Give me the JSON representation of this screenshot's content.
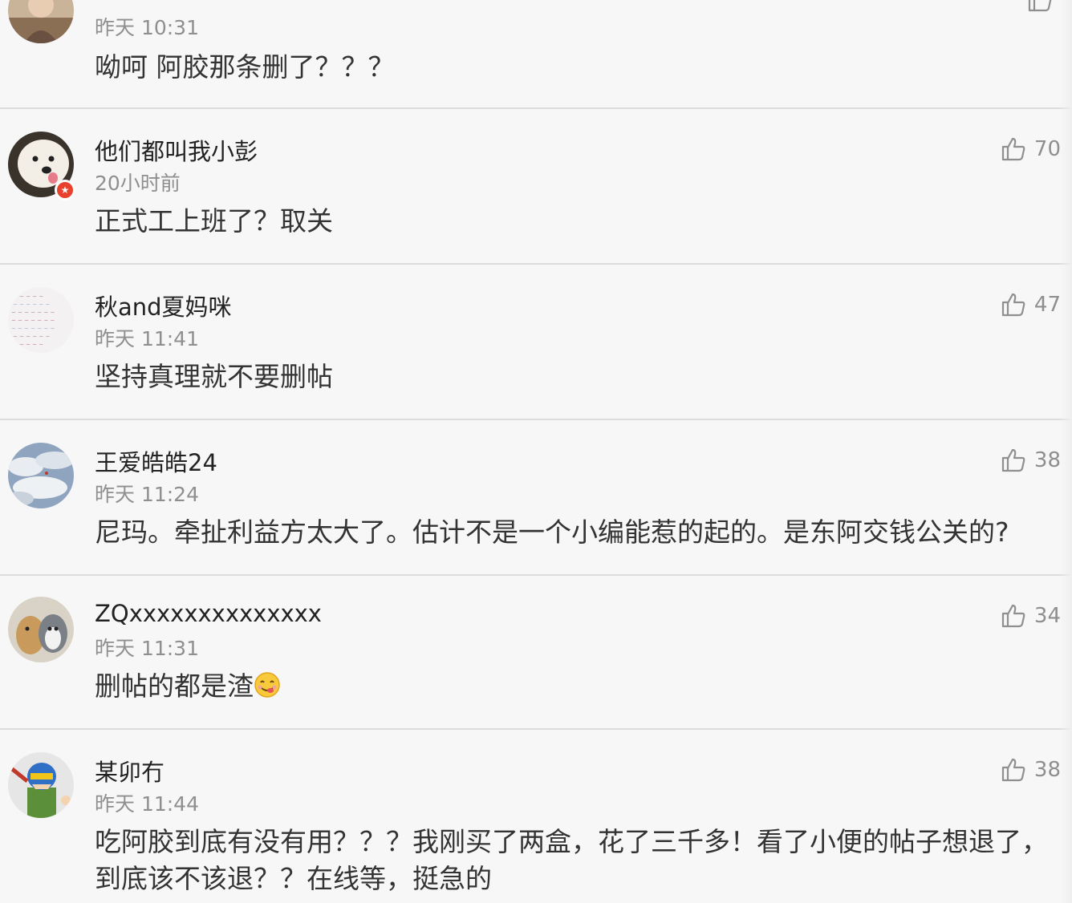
{
  "comments": [
    {
      "username": "",
      "time": "昨天 10:31",
      "content": "呦呵 阿胶那条删了？？？",
      "likes": "",
      "avatar_icon": "portrait-photo-icon"
    },
    {
      "username": "他们都叫我小彭",
      "time": "20小时前",
      "content": "正式工上班了？取关",
      "likes": "70",
      "avatar_icon": "white-dog-photo-icon",
      "verified": true
    },
    {
      "username": "秋and夏妈咪",
      "time": "昨天 11:41",
      "content": "坚持真理就不要删帖",
      "likes": "47",
      "avatar_icon": "word-cloud-icon"
    },
    {
      "username": "王爱皓皓24",
      "time": "昨天 11:24",
      "content": "尼玛。牵扯利益方太大了。估计不是一个小编能惹的起的。是东阿交钱公关的?",
      "likes": "38",
      "avatar_icon": "sky-clouds-photo-icon"
    },
    {
      "username": "ZQxxxxxxxxxxxxxx",
      "time": "昨天 11:31",
      "content": "删帖的都是渣",
      "likes": "34",
      "avatar_icon": "dogs-photo-icon",
      "emoji": "yummy-face-emoji"
    },
    {
      "username": "某卯冇",
      "time": "昨天 11:44",
      "content": "吃阿胶到底有没有用？？？我刚买了两盒，花了三千多！看了小便的帖子想退了，到底该不该退？？在线等，挺急的",
      "likes": "38",
      "avatar_icon": "cartoon-hero-icon"
    }
  ],
  "colors": {
    "background": "#f7f7f7",
    "divider": "#dcdcdc",
    "meta_text": "#8f8f8f",
    "verified_badge": "#e8412e"
  }
}
